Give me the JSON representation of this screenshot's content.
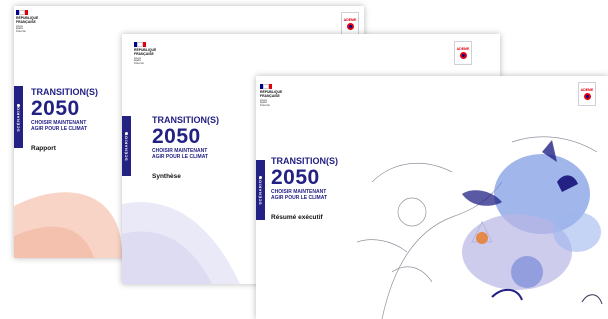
{
  "republique": {
    "text": "RÉPUBLIQUE\nFRANÇAISE",
    "motto": "Liberté\nÉgalité\nFraternité"
  },
  "flag_colors": [
    "#000091",
    "#ffffff",
    "#e1000f"
  ],
  "ademe_logo": {
    "label": "ADEME",
    "accent": "#e1000f",
    "brand": "#000091"
  },
  "title": {
    "line1": "TRANSITION(S)",
    "line2": "2050",
    "line3": "CHOISIR MAINTENANT",
    "line4": "AGIR POUR LE CLIMAT"
  },
  "bar_label": "SCÉNARIOS",
  "covers": [
    {
      "doc_type": "Rapport"
    },
    {
      "doc_type": "Synthèse"
    },
    {
      "doc_type": "Résumé exécutif"
    }
  ],
  "colors": {
    "navy": "#232184",
    "salmon": "#f6c6b3",
    "lavender": "#b9b7e6",
    "blue_blob": "#6e8fe0"
  }
}
